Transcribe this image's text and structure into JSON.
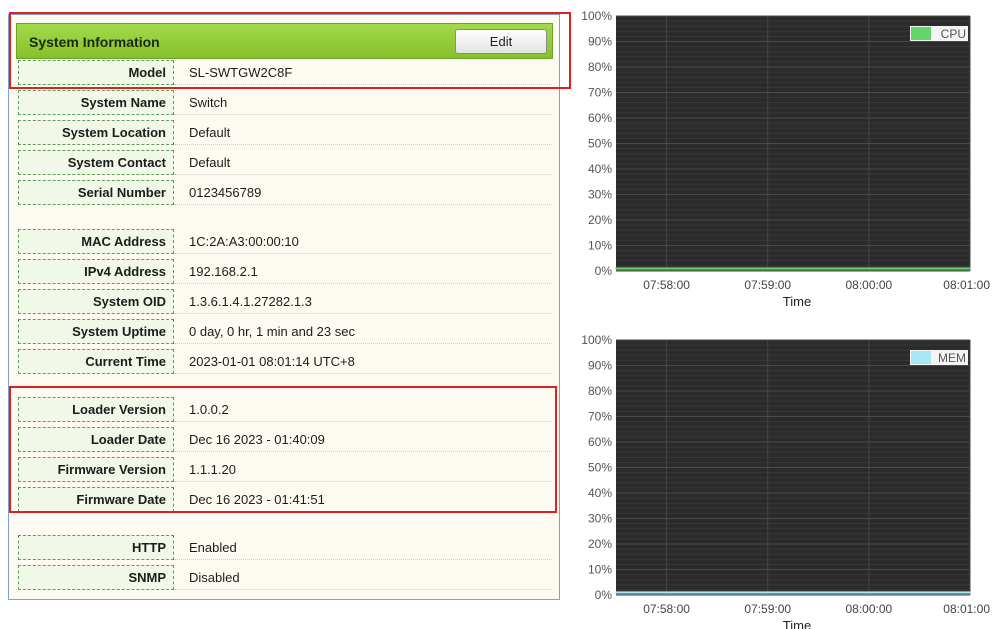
{
  "system_info": {
    "title": "System Information",
    "edit_label": "Edit",
    "rows": [
      {
        "label": "Model",
        "value": "SL-SWTGW2C8F"
      },
      {
        "label": "System Name",
        "value": "Switch"
      },
      {
        "label": "System Location",
        "value": "Default"
      },
      {
        "label": "System Contact",
        "value": "Default"
      },
      {
        "label": "Serial Number",
        "value": "0123456789"
      },
      {
        "label": "MAC Address",
        "value": "1C:2A:A3:00:00:10"
      },
      {
        "label": "IPv4 Address",
        "value": "192.168.2.1"
      },
      {
        "label": "System OID",
        "value": "1.3.6.1.4.1.27282.1.3"
      },
      {
        "label": "System Uptime",
        "value": "0 day, 0 hr, 1 min and 23 sec"
      },
      {
        "label": "Current Time",
        "value": "2023-01-01 08:01:14 UTC+8"
      },
      {
        "label": "Loader Version",
        "value": "1.0.0.2"
      },
      {
        "label": "Loader Date",
        "value": "Dec 16 2023 - 01:40:09"
      },
      {
        "label": "Firmware Version",
        "value": "1.1.1.20"
      },
      {
        "label": "Firmware Date",
        "value": "Dec 16 2023 - 01:41:51"
      },
      {
        "label": "HTTP",
        "value": "Enabled"
      },
      {
        "label": "SNMP",
        "value": "Disabled"
      }
    ]
  },
  "colors": {
    "header_green": "#8cc63f",
    "highlight_red": "#e02020",
    "chart_bg": "#2b2b2b",
    "cpu_series": "#63d36a",
    "mem_series": "#a8e6f6"
  },
  "chart_data": [
    {
      "type": "area",
      "x": [
        "07:57:30",
        "07:58:00",
        "07:58:30",
        "07:59:00",
        "07:59:30",
        "08:00:00",
        "08:00:30",
        "08:01:00"
      ],
      "x_ticks": [
        "07:58:00",
        "07:59:00",
        "08:00:00",
        "08:01:00"
      ],
      "series": [
        {
          "name": "CPU",
          "values": [
            1,
            1,
            1,
            1,
            1,
            1,
            1,
            1
          ]
        }
      ],
      "xlabel": "Time",
      "ylabel": "",
      "y_ticks": [
        "0%",
        "10%",
        "20%",
        "30%",
        "40%",
        "50%",
        "60%",
        "70%",
        "80%",
        "90%",
        "100%"
      ],
      "ylim": [
        0,
        100
      ],
      "grid": true,
      "legend": "top-right"
    },
    {
      "type": "area",
      "x": [
        "07:57:30",
        "07:58:00",
        "07:58:30",
        "07:59:00",
        "07:59:30",
        "08:00:00",
        "08:00:30",
        "08:01:00"
      ],
      "x_ticks": [
        "07:58:00",
        "07:59:00",
        "08:00:00",
        "08:01:00"
      ],
      "series": [
        {
          "name": "MEM",
          "values": [
            1,
            1,
            1,
            1,
            1,
            1,
            1,
            1
          ]
        }
      ],
      "xlabel": "Time",
      "ylabel": "",
      "y_ticks": [
        "0%",
        "10%",
        "20%",
        "30%",
        "40%",
        "50%",
        "60%",
        "70%",
        "80%",
        "90%",
        "100%"
      ],
      "ylim": [
        0,
        100
      ],
      "grid": true,
      "legend": "top-right"
    }
  ]
}
